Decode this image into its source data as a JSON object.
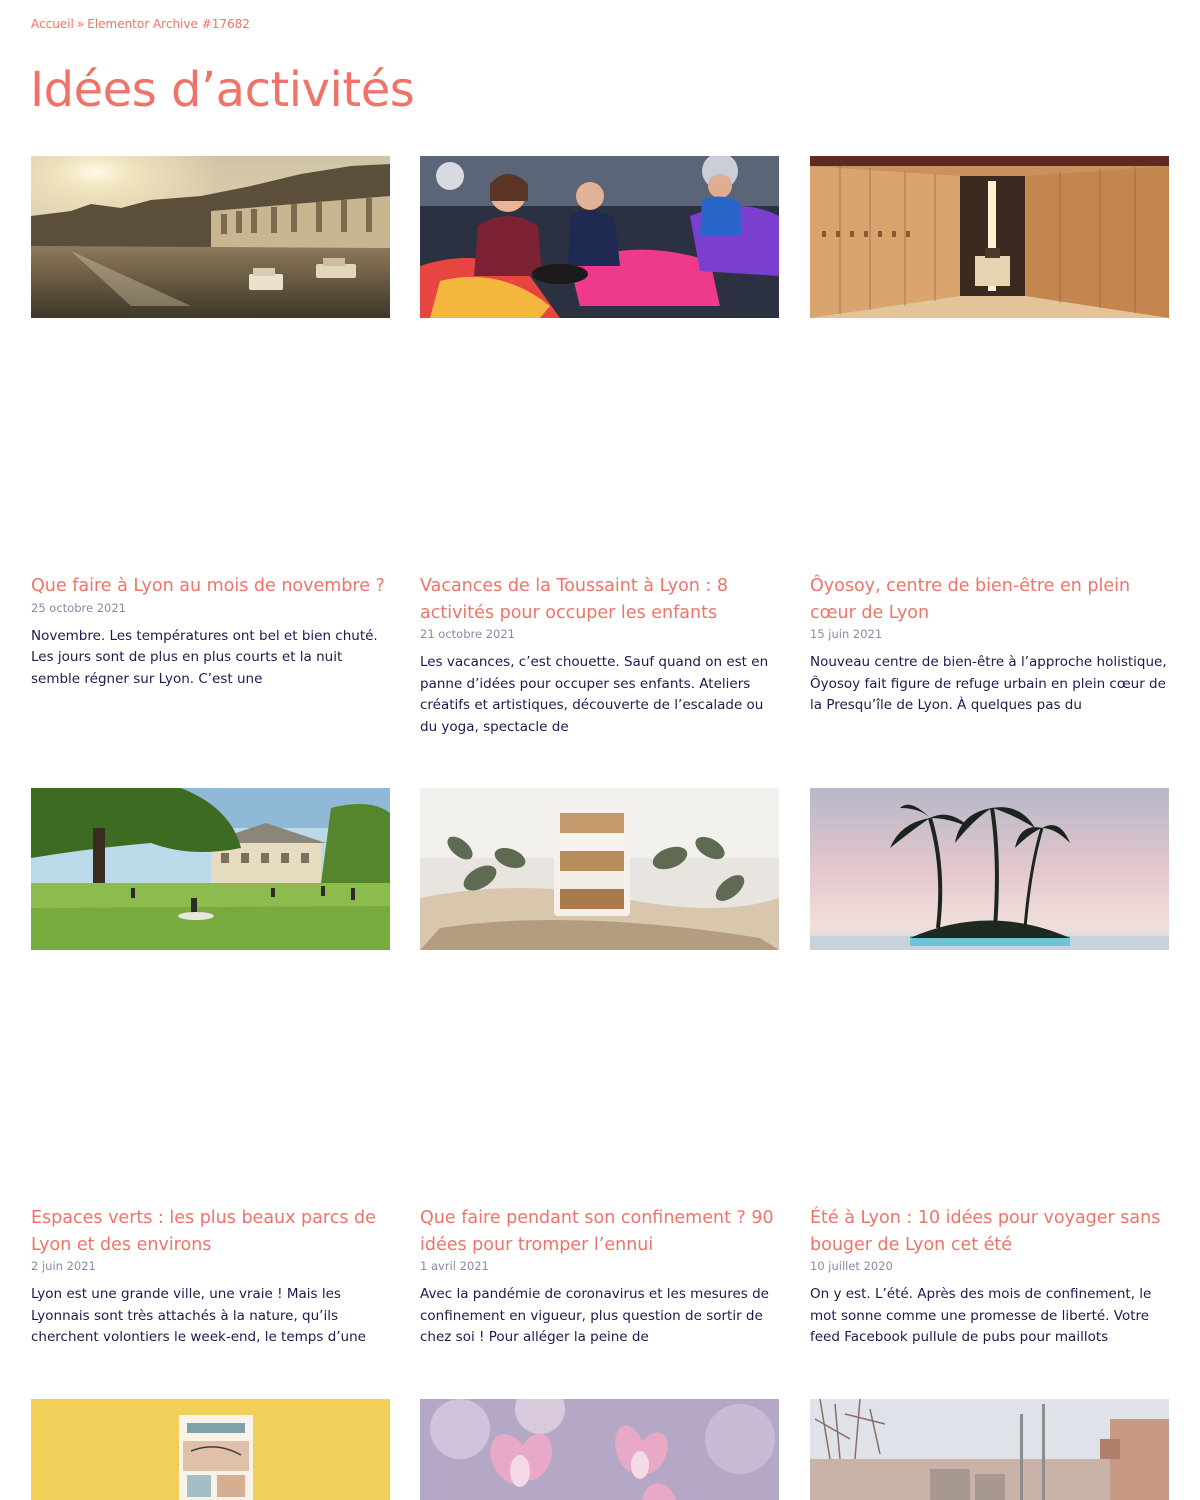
{
  "breadcrumb": {
    "home": "Accueil",
    "separator": "»",
    "current": "Elementor Archive #17682"
  },
  "page_title": "Idées d’activités",
  "colors": {
    "accent": "#f07369",
    "text": "#1d1a4e",
    "date": "#8b87a8"
  },
  "posts": [
    {
      "title": "Que faire à Lyon au mois de novembre ?",
      "date": "25 octobre 2021",
      "excerpt": "Novembre. Les températures ont bel et bien chuté. Les jours sont de plus en plus courts et la nuit semble régner sur Lyon. C’est une",
      "image": "sunset-river-lyon"
    },
    {
      "title": "Vacances de la Toussaint à Lyon : 8 activités pour occuper les enfants",
      "date": "21 octobre 2021",
      "excerpt": "Les vacances, c’est chouette. Sauf quand on est en panne d’idées pour occuper ses enfants. Ateliers créatifs et artistiques, découverte de l’escalade ou du yoga, spectacle de",
      "image": "kids-bumper-cars"
    },
    {
      "title": "Ôyosoy, centre de bien-être en plein cœur de Lyon",
      "date": "15 juin 2021",
      "excerpt": "Nouveau centre de bien-être à l’approche holistique, Ôyosoy fait figure de refuge urbain en plein cœur de la Presqu’île de Lyon. À quelques pas du",
      "image": "wellness-corridor"
    },
    {
      "title": "Espaces verts : les plus beaux parcs de Lyon et des environs",
      "date": "2 juin 2021",
      "excerpt": "Lyon est une grande ville, une vraie ! Mais les Lyonnais sont très attachés à la nature, qu’ils cherchent volontiers le week-end, le temps d’une",
      "image": "green-park"
    },
    {
      "title": "Que faire pendant son confinement ? 90 idées pour tromper l’ennui",
      "date": "1 avril 2021",
      "excerpt": "Avec la pandémie de coronavirus et les mesures de confinement en vigueur, plus question de sortir de chez soi ! Pour alléger la peine de",
      "image": "granola-jar"
    },
    {
      "title": "Été à Lyon : 10 idées pour voyager sans bouger de Lyon cet été",
      "date": "10 juillet 2020",
      "excerpt": "On y est. L’été. Après des mois de confinement, le mot sonne comme une promesse de liberté. Votre feed Facebook pullule de pubs pour maillots",
      "image": "palm-trees-pool"
    },
    {
      "title": "",
      "date": "",
      "excerpt": "",
      "image": "illustrated-book-yellow"
    },
    {
      "title": "",
      "date": "",
      "excerpt": "",
      "image": "magnolia-flowers"
    },
    {
      "title": "",
      "date": "",
      "excerpt": "",
      "image": "lyon-bridge-winter"
    }
  ]
}
